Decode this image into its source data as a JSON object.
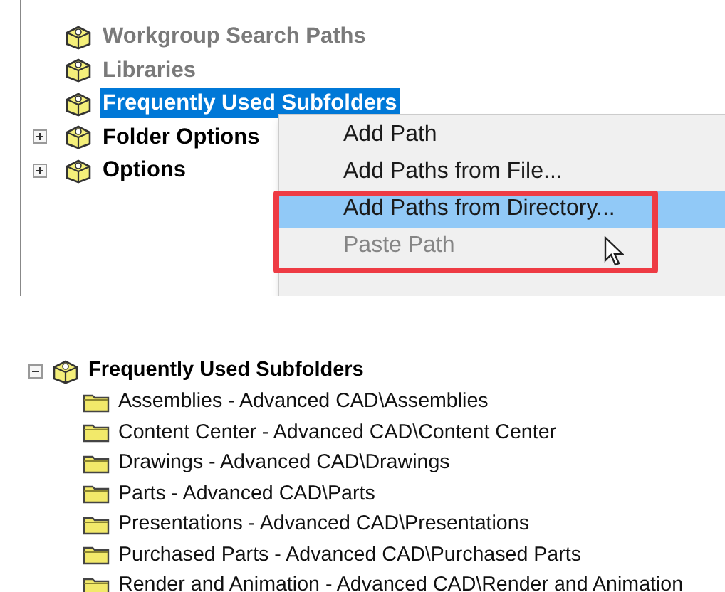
{
  "top_tree": {
    "items": [
      {
        "label": "Workgroup Search Paths",
        "muted": true,
        "selected": false,
        "expandable": false
      },
      {
        "label": "Libraries",
        "muted": true,
        "selected": false,
        "expandable": false
      },
      {
        "label": "Frequently Used Subfolders",
        "muted": false,
        "selected": true,
        "expandable": false
      },
      {
        "label": "Folder Options",
        "muted": false,
        "selected": false,
        "expandable": true
      },
      {
        "label": "Options",
        "muted": false,
        "selected": false,
        "expandable": true
      }
    ]
  },
  "context_menu": {
    "items": [
      {
        "label": "Add Path",
        "selected": false,
        "disabled": false
      },
      {
        "label": "Add Paths from File...",
        "selected": false,
        "disabled": false
      },
      {
        "label": "Add Paths from Directory...",
        "selected": true,
        "disabled": false
      },
      {
        "label": "Paste Path",
        "selected": false,
        "disabled": true
      }
    ]
  },
  "bottom_tree": {
    "label": "Frequently Used Subfolders",
    "expanded": true,
    "children": [
      {
        "label": "Assemblies - Advanced CAD\\Assemblies"
      },
      {
        "label": "Content Center - Advanced CAD\\Content Center"
      },
      {
        "label": "Drawings - Advanced CAD\\Drawings"
      },
      {
        "label": "Parts - Advanced CAD\\Parts"
      },
      {
        "label": "Presentations - Advanced CAD\\Presentations"
      },
      {
        "label": "Purchased Parts - Advanced CAD\\Purchased Parts"
      },
      {
        "label": "Render and Animation - Advanced CAD\\Render and Animation"
      }
    ]
  }
}
